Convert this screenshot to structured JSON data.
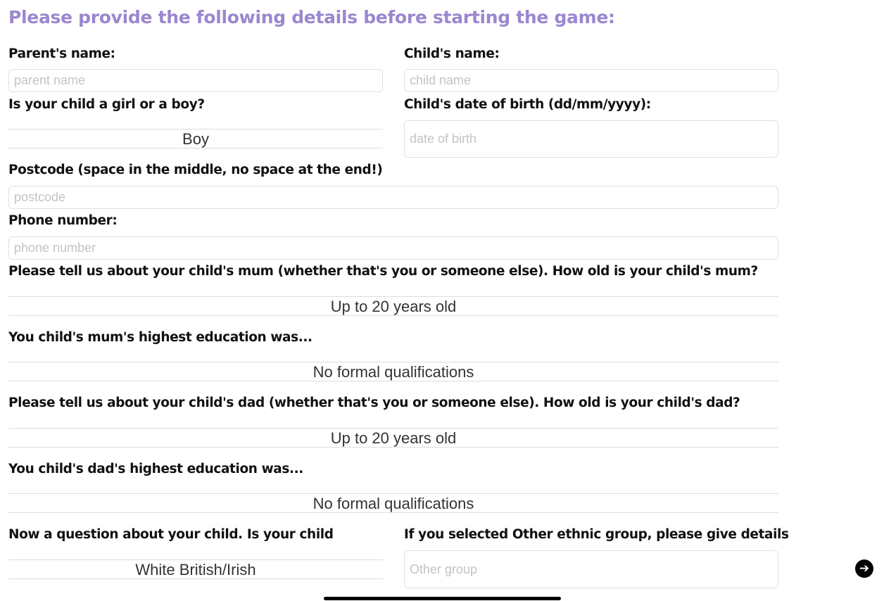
{
  "title": "Please provide the following details before starting the game:",
  "parent_name": {
    "label": "Parent's name:",
    "placeholder": "parent name",
    "value": ""
  },
  "child_name": {
    "label": "Child's name:",
    "placeholder": "child name",
    "value": ""
  },
  "gender": {
    "label": "Is your child a girl or a boy?",
    "selected": "Boy"
  },
  "dob": {
    "label": "Child's date of birth (dd/mm/yyyy):",
    "placeholder": "date of birth",
    "value": ""
  },
  "postcode": {
    "label": "Postcode (space in the middle, no space at the end!)",
    "placeholder": "postcode",
    "value": ""
  },
  "phone": {
    "label": "Phone number:",
    "placeholder": "phone number",
    "value": ""
  },
  "mum_age": {
    "label": "Please tell us about your child's mum (whether that's you or someone else). How old is your child's mum?",
    "selected": "Up to 20 years old"
  },
  "mum_edu": {
    "label": "You child's mum's highest education was...",
    "selected": "No formal qualifications"
  },
  "dad_age": {
    "label": "Please tell us about your child's dad (whether that's you or someone else). How old is your child's dad?",
    "selected": "Up to 20 years old"
  },
  "dad_edu": {
    "label": "You child's dad's highest education was...",
    "selected": "No formal qualifications"
  },
  "ethnicity": {
    "label": "Now a question about your child. Is your child",
    "selected": "White British/Irish"
  },
  "other_group": {
    "label": "If you selected Other ethnic group, please give details",
    "placeholder": "Other group",
    "value": ""
  },
  "next_button": {
    "icon": "arrow-right-circle-icon",
    "glyph": "➔"
  },
  "colors": {
    "title": "#9b87cf"
  }
}
